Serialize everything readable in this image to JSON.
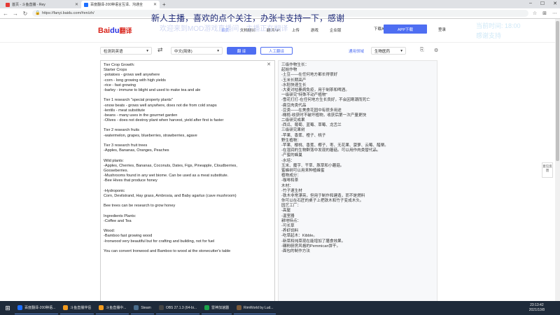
{
  "browser": {
    "tabs": [
      {
        "title": "首页 - 斗鱼直播 - Rey",
        "active": false
      },
      {
        "title": "百度翻译-200种语言互译、沟通全",
        "active": true
      }
    ],
    "url": "https://fanyi.baidu.com/#en/zh/"
  },
  "header": {
    "logo_text": "Bai",
    "logo_paw": "du",
    "logo_suffix": "翻译",
    "nav": [
      "首页",
      "文档翻译",
      "翻译API",
      "上传",
      "游戏",
      "企业版"
    ],
    "download": "下载APP",
    "app_button": "APP下载",
    "login": "登录"
  },
  "toolbar": {
    "source_lang": "检测到英语",
    "target_lang": "中文(简体)",
    "translate": "翻 译",
    "human_translate": "人工翻译",
    "domain_label": "通用领域",
    "domain_value": "生物医药"
  },
  "source_lines": [
    "Tier Crop Growth:",
    "Starter Crops",
    "-potatoes - grows well anywhere",
    "-corn - long growing with high yields",
    "-rice - fast growing",
    "-barley - immune to blight and used to make tea and ale",
    "",
    "Tier 1 research \"special property plants\"",
    "-snow beats - grows well anywhere, does not die from cold snaps",
    "-lentils - meat substitute",
    "-beans - many uses in the gourmet garden",
    "-Olives - does not destroy plant when harvest, yield after first is faster",
    "",
    "Tier 2 research fruits",
    "-watermelon, grapes, blueberries, strawberries, agave",
    "",
    "Tier 3 research fruit trees",
    "-Apples, Bananas, Oranges, Peaches",
    "",
    "Wild plants:",
    "-Apples, Cherries, Bananas, Coconuts, Dates, Figs, Pineapple, Cloudberries,",
    "Gooseberries.",
    "-Mushrooms found in any wet biome. Can be used as a meat substitute.",
    "-Bee Hives that produce honey",
    "",
    "-Hydroponic",
    "Corn, Devilstrand, Hay grass, Ambrosia, and Baby agarlux (cave mushroom)",
    "",
    "Bee trees can be research to grow honey",
    "",
    "Ingredients Plants:",
    "-Coffee and Tea",
    "",
    "Wood:",
    "-Bamboo fast growing wood",
    "-Ironwood very beautiful but for crafting and building, not for fuel",
    "",
    "You can convert Ironwood and Bamboo to wood at the stonecutter's table"
  ],
  "target_lines": [
    "三级作物生长：",
    "起始作物",
    "-土豆——在任何地方都长得很好",
    "-玉米长期高产",
    "-水稻快速生长",
    "-大麦对枯萎病免疫，用于制茶和啤酒。",
    "一级研究\"特殊不动产植物\"",
    "-雪花打打-在任何地方生长良好，不会因寒潮而死亡",
    "-扁豆肉类代品",
    "-豆类——在美食花园中有很多用途",
    "-橄榄-收获时不破坏植物，收获后第一次产量更快",
    "二级研究成果",
    "-西瓜、葡萄、蓝莓、草莓、龙舌兰",
    "三级研究果树",
    "-苹果、香蕉、橙子、桃子",
    "野生植物：",
    "-苹果、樱桃、香蕉、椰子、枣、无花果、菠萝、云莓、醋栗。",
    "-在湿润的生物群落中发现的蘑菇。可以用作肉类替代品。",
    "-产蜜的蜂巢",
    "-水培：",
    "玉米、魔字、干草、豚草和小蘑菇。",
    "蜜蜂树可以用来种植蜂蜜",
    "植物成分：",
    "-咖啡和茶",
    "木材：",
    "-竹子速生材",
    "-铁木非常漂亮，但用于制作和建造，而不是燃料",
    "你可以在石匠的桌子上把铁木和竹子变成木头。",
    "园艺工厂：",
    "-高屋",
    "-温室器",
    "耕地特点：",
    "-可长草",
    "-养虾饲料",
    "-吃草起木：Kibble。",
    "-新菜和炖菜现在能增加了膳食效果。",
    "-碾粉厨房风格的Pemmican饼干。",
    "-面包的制作方法"
  ],
  "side_feedback": "意见反馈",
  "overlay": {
    "line1": "新人主播，喜欢的点个关注，办张卡支持一下，感谢",
    "line2": "欢迎来到MOD游戏直播间，主播正在翻译",
    "side1": "当前时间: 18:00",
    "side2": "感谢支持"
  },
  "taskbar": {
    "items": [
      {
        "label": "百度翻译-200种语...",
        "color": "#1e6fff"
      },
      {
        "label": "斗鱼直播伴侣",
        "color": "#f29b1f"
      },
      {
        "label": "斗鱼直播中...",
        "color": "#f29b1f"
      },
      {
        "label": "Steam",
        "color": "#4a6d8c"
      },
      {
        "label": "OBS 27.1.3 (64-bi...",
        "color": "#444444"
      },
      {
        "label": "雷神加速器",
        "color": "#1aa34a"
      },
      {
        "label": "RimWorld by Lud...",
        "color": "#7a5a3a"
      }
    ],
    "time": "23:13:42",
    "date": "2021/10/8"
  }
}
